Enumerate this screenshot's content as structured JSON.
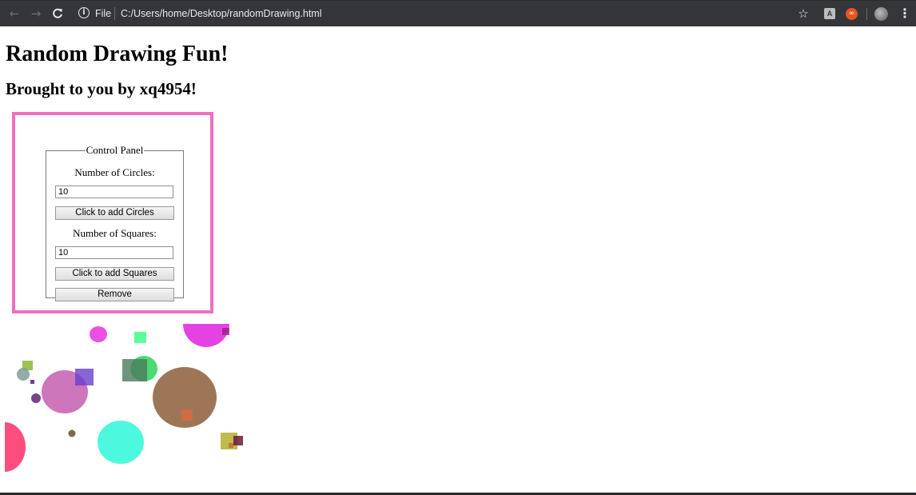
{
  "browser": {
    "back_icon": "←",
    "forward_icon": "→",
    "reload_icon": "C",
    "info_icon": "i",
    "file_label": "File",
    "url": "C:/Users/home/Desktop/randomDrawing.html",
    "star_icon": "☆",
    "ext1_label": "A",
    "ext2_label": "∞",
    "menu_icon": "⋮"
  },
  "page": {
    "title": "Random Drawing Fun!",
    "subtitle": "Brought to you by xq4954!"
  },
  "control_panel": {
    "legend": "Control Panel",
    "circles_label": "Number of Circles:",
    "circles_value": "10",
    "add_circles_button": "Click to add Circles",
    "squares_label": "Number of Squares:",
    "squares_value": "10",
    "add_squares_button": "Click to add Squares",
    "remove_button": "Remove"
  },
  "colors": {
    "panel_border": "#f06ec0",
    "toolbar_bg": "#35363a"
  }
}
